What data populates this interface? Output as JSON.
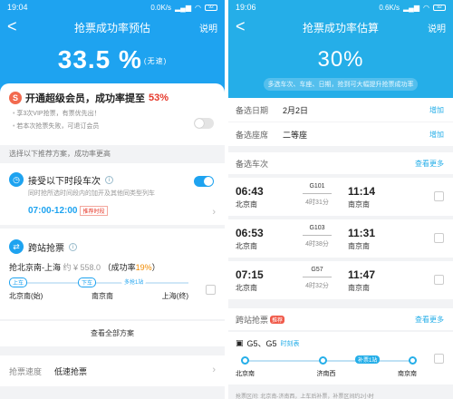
{
  "left": {
    "status": {
      "time": "19:04",
      "speed": "0.0K/s",
      "battery": "92"
    },
    "nav": {
      "back": "<",
      "title": "抢票成功率预估",
      "help": "说明"
    },
    "rate": {
      "value": "33.5 %",
      "suffix": "(无速)"
    },
    "vip": {
      "title_prefix": "开通超级会员，成功率提至",
      "title_rate": "53%",
      "bullets": [
        "享3次VIP抢票，有票优先出！",
        "若本次抢票失败，可退订会员"
      ]
    },
    "section_hint": "选择以下推荐方案，成功率更高",
    "alt_trains": {
      "title": "接受以下时段车次",
      "desc": "同时抢所选时间段内的加开及其他同类型列车",
      "range": "07:00-12:00",
      "tag": "推荐时段"
    },
    "cross_station": {
      "title": "跨站抢票",
      "route": "抢北京南-上海",
      "price": "约 ¥ 558.0",
      "rate_label": "（成功率",
      "rate_value": "19%",
      "rate_close": "）",
      "pill_board": "上车",
      "pill_alight": "下车",
      "extra": "多抢1站",
      "stations": [
        "北京南(始)",
        "南京南",
        "上海(终)"
      ]
    },
    "view_all": "查看全部方案",
    "speed": {
      "label": "抢票速度",
      "value": "低速抢票"
    }
  },
  "right": {
    "status": {
      "time": "19:06",
      "speed": "0.6K/s",
      "battery": "92"
    },
    "nav": {
      "back": "<",
      "title": "抢票成功率估算",
      "help": "说明"
    },
    "rate": {
      "value": "30%"
    },
    "hint": "多选车次、车座、日期，抢到可大幅提升抢票成功率",
    "date": {
      "label": "备选日期",
      "value": "2月2日",
      "link": "增加"
    },
    "seat": {
      "label": "备选座席",
      "value": "二等座",
      "link": "增加"
    },
    "trains_header": {
      "label": "备选车次",
      "link": "查看更多"
    },
    "trains": [
      {
        "dep": "06:43",
        "no": "G101",
        "dur": "4时31分",
        "arr": "11:14",
        "from": "北京南",
        "to": "南京南"
      },
      {
        "dep": "06:53",
        "no": "G103",
        "dur": "4时38分",
        "arr": "11:31",
        "from": "北京南",
        "to": "南京南"
      },
      {
        "dep": "07:15",
        "no": "G57",
        "dur": "4时32分",
        "arr": "11:47",
        "from": "北京南",
        "to": "南京南"
      }
    ],
    "cross_header": {
      "label": "跨站抢票",
      "badge": "推荐",
      "link": "查看更多"
    },
    "cross": {
      "trains": "G5、G5",
      "timetable": "时刻表",
      "mid_pill": "补票1站",
      "stations": [
        "北京南",
        "济南西",
        "南京南"
      ],
      "footnote": "抢票区间: 北京南-济南西，上车后补票，补票区间约2小时"
    }
  },
  "colors": {
    "accent": "#1ea3f0",
    "accent_right": "#25aee8",
    "red": "#e6392b",
    "orange": "#f08a00"
  },
  "icons": [
    "back-arrow-icon",
    "wifi-icon",
    "battery-icon",
    "vip-icon",
    "clock-icon",
    "transfer-icon",
    "info-icon",
    "chevron-right-icon",
    "train-icon"
  ]
}
